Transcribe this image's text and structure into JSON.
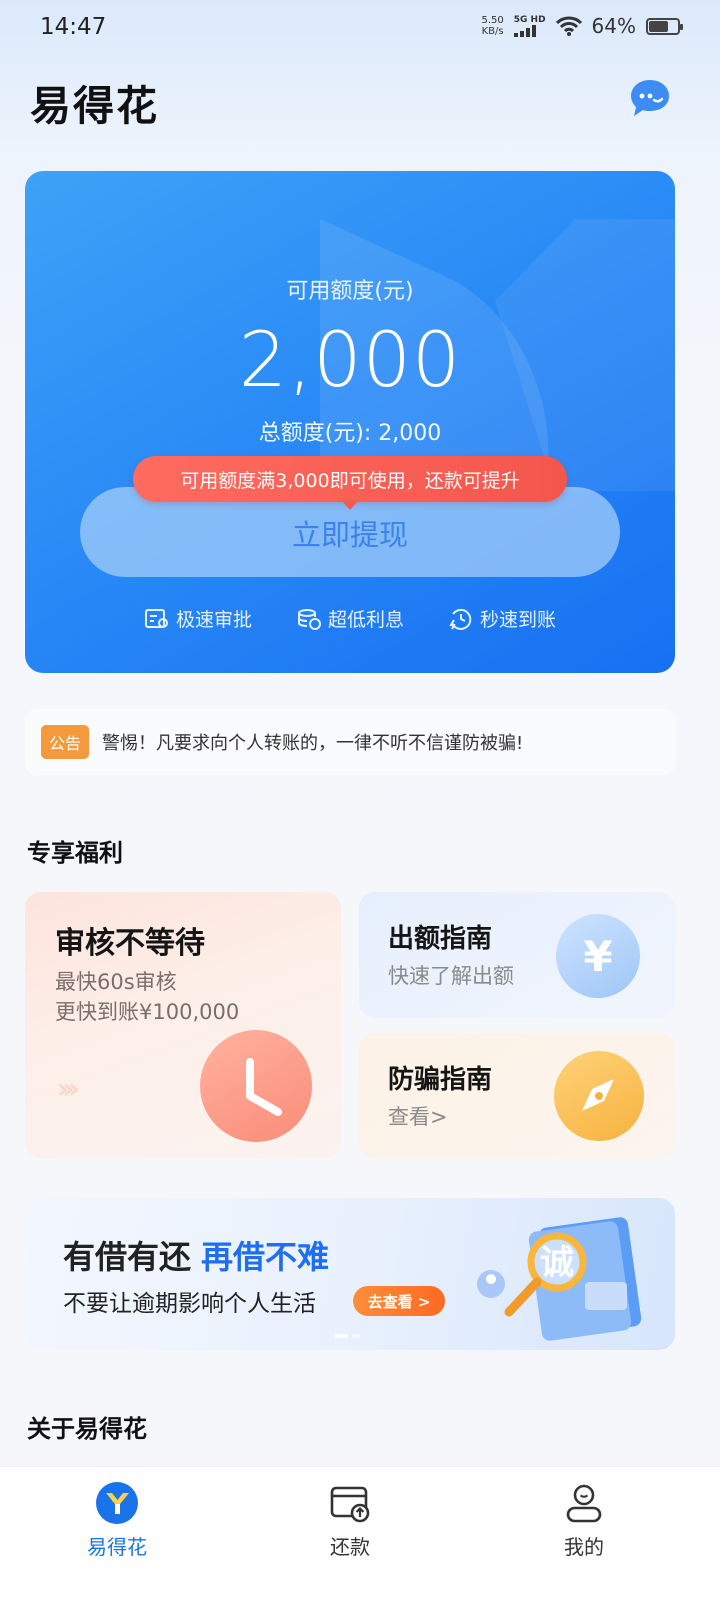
{
  "status_bar": {
    "time": "14:47",
    "net_speed_value": "5.50",
    "net_speed_unit": "KB/s",
    "signal_label": "5G HD",
    "battery_percent": "64%",
    "battery_level": 0.64
  },
  "header": {
    "app_title": "易得花",
    "chat_icon": "chat-bubble-icon"
  },
  "credit_card": {
    "available_label": "可用额度(元)",
    "available_amount": "2,000",
    "total_label": "总额度(元): 2,000",
    "tip": "可用额度满3,000即可使用，还款可提升",
    "withdraw_button": "立即提现",
    "features": [
      {
        "icon": "approval-icon",
        "label": "极速审批"
      },
      {
        "icon": "coins-icon",
        "label": "超低利息"
      },
      {
        "icon": "clock-fast-icon",
        "label": "秒速到账"
      }
    ]
  },
  "notice": {
    "tag": "公告",
    "text": "警惕！凡要求向个人转账的，一律不听不信谨防被骗!"
  },
  "benefits": {
    "section_title": "专享福利",
    "review": {
      "title": "审核不等待",
      "line1": "最快60s审核",
      "line2": "更快到账¥100,000",
      "arrows": "›››"
    },
    "quota_guide": {
      "title": "出额指南",
      "subtitle": "快速了解出额",
      "icon_glyph": "¥"
    },
    "fraud_guide": {
      "title": "防骗指南",
      "subtitle": "查看>"
    }
  },
  "promo": {
    "headline_a": "有借有还",
    "headline_b": "再借不难",
    "subtitle": "不要让逾期影响个人生活",
    "button": "去查看 >",
    "image_text": "诚"
  },
  "about": {
    "section_title": "关于易得花"
  },
  "bottom_nav": {
    "items": [
      {
        "label": "易得花",
        "active": true,
        "icon": "home-logo-icon"
      },
      {
        "label": "还款",
        "active": false,
        "icon": "repay-card-icon"
      },
      {
        "label": "我的",
        "active": false,
        "icon": "profile-icon"
      }
    ],
    "active_color": "#1a73e8",
    "inactive_color": "#333333"
  }
}
